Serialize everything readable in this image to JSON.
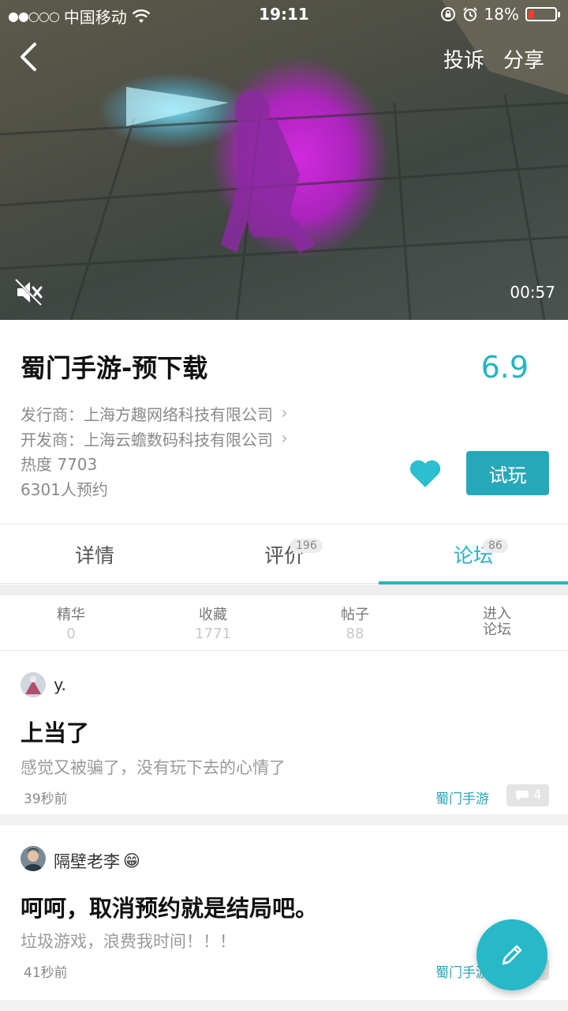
{
  "status_bar": {
    "signal_dots": "●●○○○",
    "carrier": "中国移动",
    "time": "19:11",
    "battery_text": "18%"
  },
  "video": {
    "complain_label": "投诉",
    "share_label": "分享",
    "duration": "00:57"
  },
  "game": {
    "title": "蜀门手游-预下载",
    "score": "6.9",
    "publisher": "发行商：上海方趣网络科技有限公司",
    "developer": "开发商：上海云蟾数码科技有限公司",
    "heat": "热度 7703",
    "reservations": "6301人预约",
    "try_label": "试玩"
  },
  "tabs": [
    {
      "label": "详情",
      "badge": ""
    },
    {
      "label": "评价",
      "badge": "196"
    },
    {
      "label": "论坛",
      "badge": "86"
    }
  ],
  "stats": [
    {
      "label": "精华",
      "value": "0"
    },
    {
      "label": "收藏",
      "value": "1771"
    },
    {
      "label": "帖子",
      "value": "88"
    },
    {
      "label": "进入\n论坛",
      "value": ""
    }
  ],
  "posts": [
    {
      "user": "y.",
      "emoji": "",
      "title": "上当了",
      "body": "感觉又被骗了，没有玩下去的心情了",
      "time": "39秒前",
      "tag": "蜀门手游",
      "comments": "4"
    },
    {
      "user": "隔壁老李",
      "emoji": "😁",
      "title": "呵呵，取消预约就是结局吧。",
      "body": "垃圾游戏，浪费我时间！！！",
      "time": "41秒前",
      "tag": "蜀门手游",
      "comments": ""
    }
  ],
  "colors": {
    "accent": "#27b3c2",
    "button": "#27a8b9"
  }
}
